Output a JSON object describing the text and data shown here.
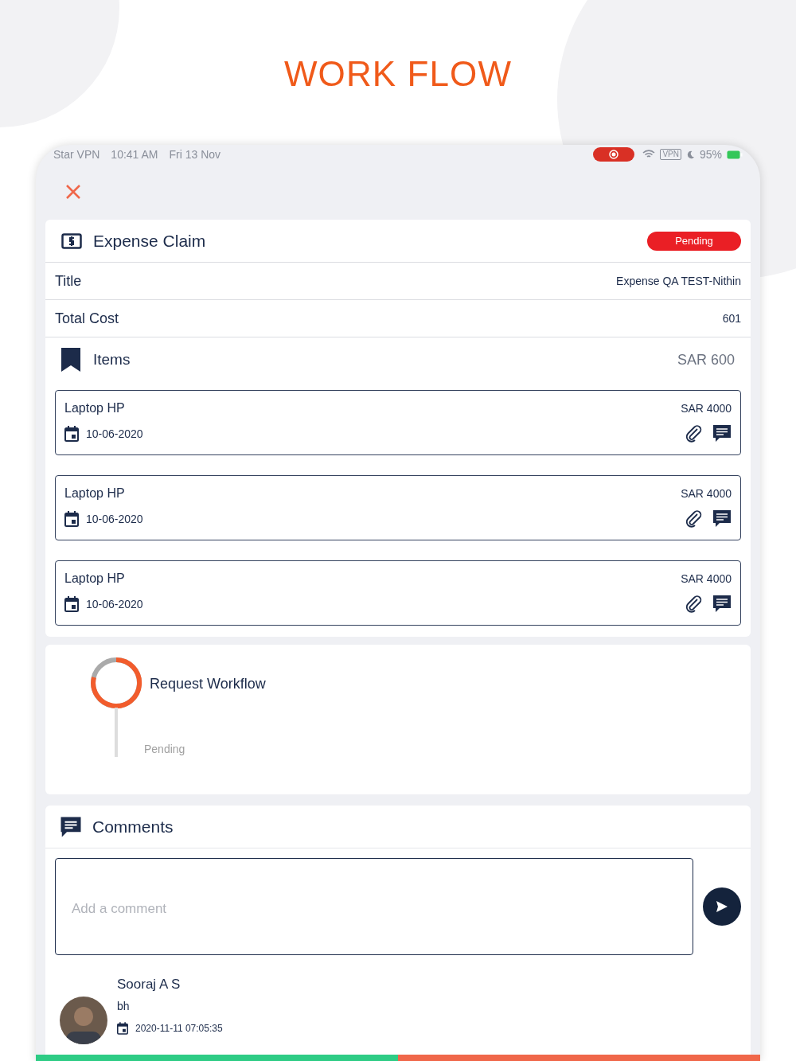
{
  "headline": "WORK FLOW",
  "status_bar": {
    "items": [
      "Star VPN",
      "10:41 AM",
      "Fri 13 Nov"
    ],
    "vpn": "VPN",
    "battery": "95%"
  },
  "expense": {
    "title": "Expense Claim",
    "status": "Pending",
    "fields": [
      {
        "label": "Title",
        "value": "Expense QA TEST-Nithin"
      },
      {
        "label": "Total Cost",
        "value": "601"
      }
    ],
    "items_label": "Items",
    "items_total": "SAR 600",
    "items": [
      {
        "name": "Laptop HP",
        "amount": "SAR 4000",
        "date": "10-06-2020"
      },
      {
        "name": "Laptop HP",
        "amount": "SAR 4000",
        "date": "10-06-2020"
      },
      {
        "name": "Laptop HP",
        "amount": "SAR 4000",
        "date": "10-06-2020"
      }
    ]
  },
  "workflow": {
    "title": "Request Workflow",
    "status": "Pending"
  },
  "comments": {
    "title": "Comments",
    "placeholder": "Add a comment",
    "entries": [
      {
        "author": "Sooraj A S",
        "text": "bh",
        "datetime": "2020-11-11 07:05:35"
      }
    ]
  },
  "actions": [
    {
      "color": "#2ecc85"
    },
    {
      "color": "#f0674a"
    }
  ]
}
